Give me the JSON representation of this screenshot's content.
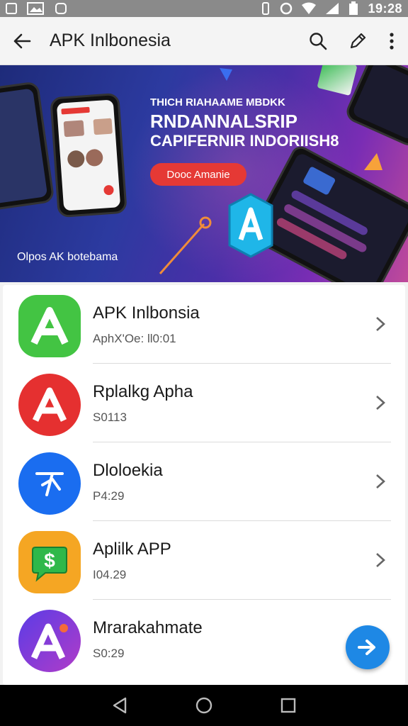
{
  "status_bar": {
    "time": "19:28",
    "icons": [
      "image-icon",
      "photo-icon",
      "notification-icon",
      "vibrate-icon",
      "alarm-icon",
      "wifi-icon",
      "signal-icon",
      "battery-icon"
    ]
  },
  "app_bar": {
    "title": "APK Inlbonesia",
    "icons": [
      "back-arrow-icon",
      "search-icon",
      "edit-icon",
      "more-vert-icon"
    ]
  },
  "banner": {
    "line1": "THICH RIAHAAME MBDKK",
    "line2": "RNDANNALSRIP",
    "line3": "CAPIFERNIR INDORIISH8",
    "cta": "Dooc Amanie",
    "footer": "Olpos AK botebama",
    "colors": {
      "cta": "#e53935",
      "accent": "#1fb6e8"
    }
  },
  "apps": [
    {
      "name": "APK Inlbonsia",
      "sub": "AphX'Oe: ll0:01",
      "icon": "apk-a-icon",
      "color": "#43c443"
    },
    {
      "name": "Rplalkg Apha",
      "sub": "S0113",
      "icon": "apk-a-icon",
      "color": "#e53030"
    },
    {
      "name": "Dloloekia",
      "sub": "P4:29",
      "icon": "plane-icon",
      "color": "#1a6df0"
    },
    {
      "name": "Aplilk APP",
      "sub": "I04.29",
      "icon": "dollar-chat-icon",
      "color": "#f5a623"
    },
    {
      "name": "Mrarakahmate",
      "sub": "S0:29",
      "icon": "apk-a-icon",
      "color": "#7a3ce0"
    }
  ],
  "fab": {
    "icon": "forward-arrow-icon",
    "color": "#1e88e5"
  },
  "nav_bar": {
    "icons": [
      "back-triangle-icon",
      "home-circle-icon",
      "recents-square-icon"
    ]
  }
}
